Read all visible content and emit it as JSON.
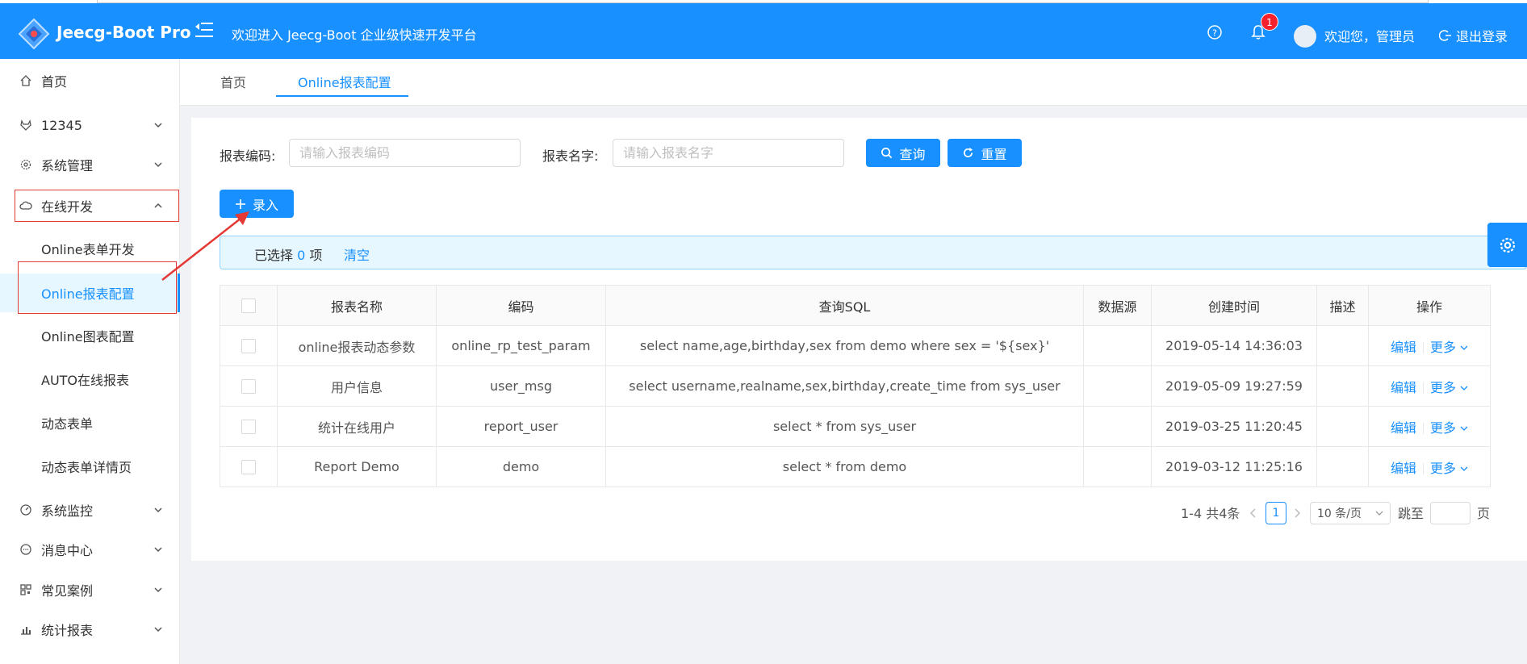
{
  "header": {
    "app_name": "Jeecg-Boot Pro",
    "welcome": "欢迎进入 Jeecg-Boot 企业级快速开发平台",
    "notification_count": "1",
    "user_greeting": "欢迎您，管理员",
    "logout_label": "退出登录",
    "bg_color": "#1890ff"
  },
  "sidebar": {
    "items": [
      {
        "label": "首页",
        "icon": "home-icon"
      },
      {
        "label": "12345",
        "icon": "gitlab-icon"
      },
      {
        "label": "系统管理",
        "icon": "gear-icon"
      },
      {
        "label": "在线开发",
        "icon": "cloud-icon"
      },
      {
        "label": "Online表单开发"
      },
      {
        "label": "Online报表配置"
      },
      {
        "label": "Online图表配置"
      },
      {
        "label": "AUTO在线报表"
      },
      {
        "label": "动态表单"
      },
      {
        "label": "动态表单详情页"
      },
      {
        "label": "系统监控",
        "icon": "dashboard-icon"
      },
      {
        "label": "消息中心",
        "icon": "message-icon"
      },
      {
        "label": "常见案例",
        "icon": "qrcode-icon"
      },
      {
        "label": "统计报表",
        "icon": "bar-chart-icon"
      }
    ]
  },
  "tabs": [
    {
      "label": "首页"
    },
    {
      "label": "Online报表配置"
    }
  ],
  "search": {
    "code_label": "报表编码:",
    "code_placeholder": "请输入报表编码",
    "name_label": "报表名字:",
    "name_placeholder": "请输入报表名字",
    "query_label": "查询",
    "reset_label": "重置"
  },
  "add_button_label": "录入",
  "selection": {
    "prefix": "已选择",
    "count": "0",
    "suffix": "项",
    "clear_label": "清空"
  },
  "table": {
    "columns": [
      "报表名称",
      "编码",
      "查询SQL",
      "数据源",
      "创建时间",
      "描述",
      "操作"
    ],
    "rows": [
      {
        "name": "online报表动态参数",
        "code": "online_rp_test_param",
        "sql": "select name,age,birthday,sex from demo where sex = '${sex}'",
        "datasource": "",
        "created": "2019-05-14 14:36:03",
        "desc": ""
      },
      {
        "name": "用户信息",
        "code": "user_msg",
        "sql": "select username,realname,sex,birthday,create_time from sys_user",
        "datasource": "",
        "created": "2019-05-09 19:27:59",
        "desc": ""
      },
      {
        "name": "统计在线用户",
        "code": "report_user",
        "sql": "select * from sys_user",
        "datasource": "",
        "created": "2019-03-25 11:20:45",
        "desc": ""
      },
      {
        "name": "Report Demo",
        "code": "demo",
        "sql": "select * from demo",
        "datasource": "",
        "created": "2019-03-12 11:25:16",
        "desc": ""
      }
    ],
    "edit_label": "编辑",
    "more_label": "更多"
  },
  "pagination": {
    "summary": "1-4 共4条",
    "current_page": "1",
    "page_size": "10 条/页",
    "jump_label": "跳至",
    "page_suffix": "页"
  }
}
